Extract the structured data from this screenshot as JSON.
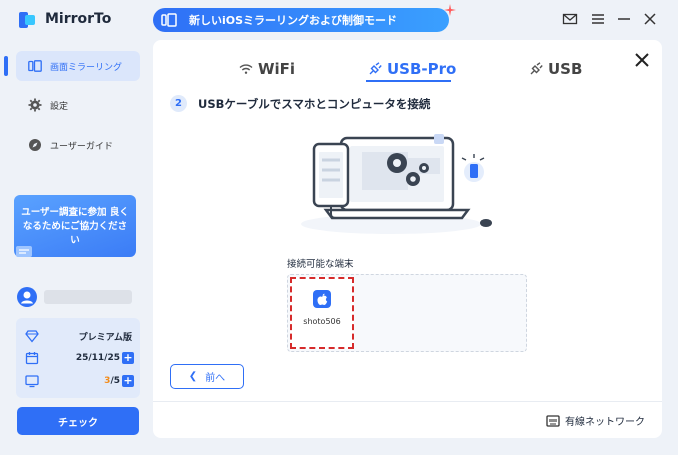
{
  "app": {
    "title": "MirrorTo"
  },
  "promo": {
    "text": "新しいiOSミラーリングおよび制御モード"
  },
  "sidebar": {
    "items": [
      {
        "label": "画面ミラーリング",
        "icon": "screen-mirror-icon",
        "active": true
      },
      {
        "label": "設定",
        "icon": "gear-icon",
        "active": false
      },
      {
        "label": "ユーザーガイド",
        "icon": "compass-icon",
        "active": false
      }
    ],
    "survey": {
      "text": "ユーザー調査に参加 良くなるためにご協力ください"
    },
    "plan": {
      "name": "プレミアム版",
      "expiry": "25/11/25",
      "devices_used": "3",
      "devices_total": "/5"
    },
    "check_label": "チェック"
  },
  "main": {
    "tabs": [
      {
        "label": "WiFi",
        "icon": "wifi-icon",
        "active": false
      },
      {
        "label": "USB-Pro",
        "icon": "usb-plug-icon",
        "active": true
      },
      {
        "label": "USB",
        "icon": "usb-plug-icon",
        "active": false
      }
    ],
    "step": {
      "number": "2",
      "text": "USBケーブルでスマホとコンピュータを接続"
    },
    "devices_label": "接続可能な端末",
    "devices": [
      {
        "name": "shoto506",
        "icon": "apple-icon"
      }
    ],
    "back_label": "前へ",
    "wired_label": "有線ネットワーク"
  },
  "colors": {
    "accent": "#2f6ff6",
    "highlight": "#d62b2b",
    "sidebar_bg": "#eef2f8"
  }
}
